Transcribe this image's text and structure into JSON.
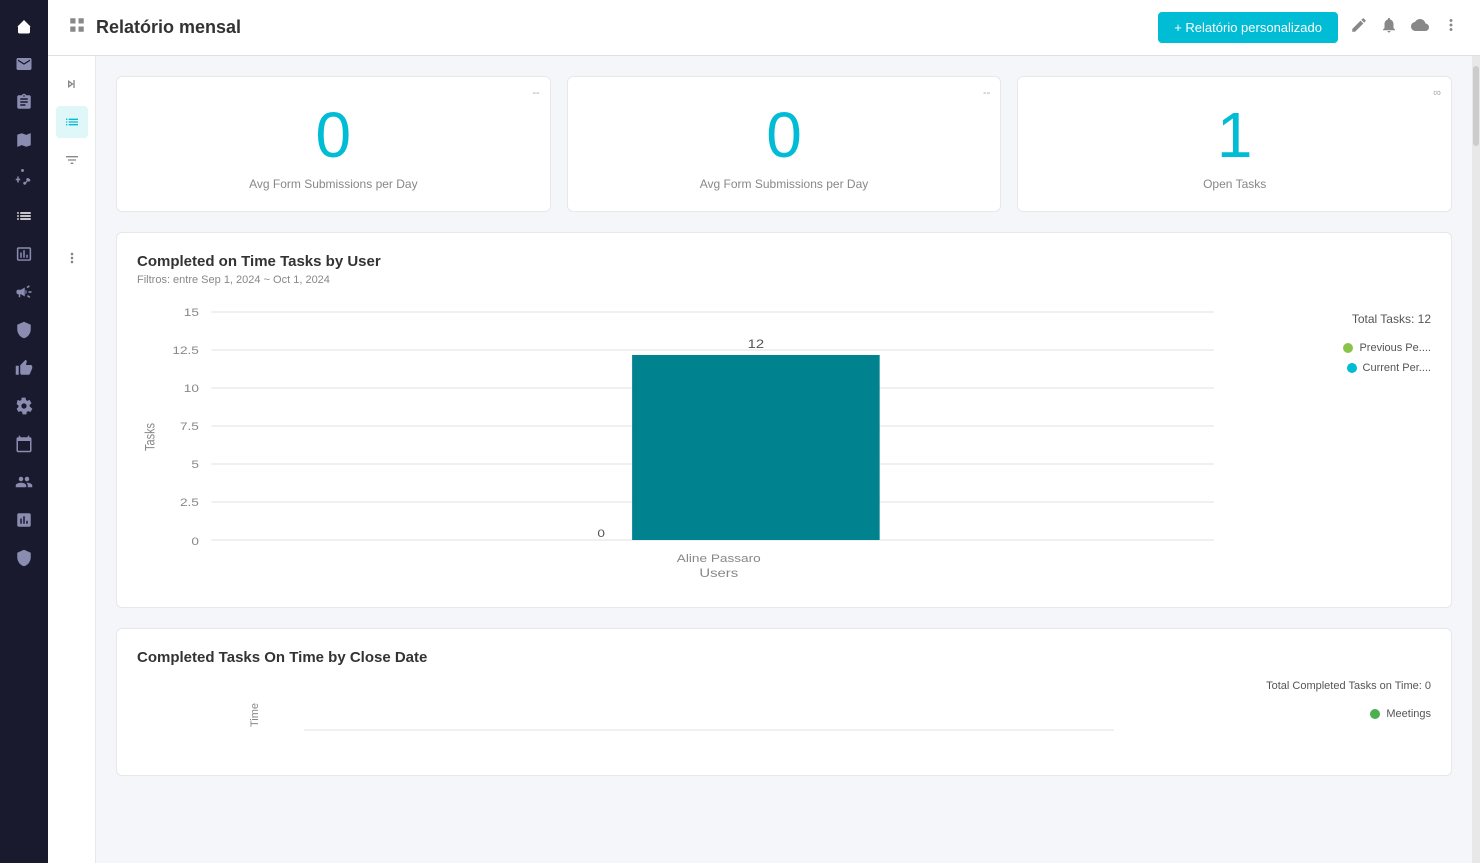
{
  "sidebar": {
    "icons": [
      {
        "name": "home-icon",
        "symbol": "⊞"
      },
      {
        "name": "email-icon",
        "symbol": "✉"
      },
      {
        "name": "document-icon",
        "symbol": "📋"
      },
      {
        "name": "map-icon",
        "symbol": "🗺"
      },
      {
        "name": "branch-icon",
        "symbol": "⑂"
      },
      {
        "name": "list-icon",
        "symbol": "☰"
      },
      {
        "name": "report-icon",
        "symbol": "📊"
      },
      {
        "name": "megaphone-icon",
        "symbol": "📣"
      },
      {
        "name": "badge-icon",
        "symbol": "🏅"
      },
      {
        "name": "thumb-icon",
        "symbol": "👍"
      },
      {
        "name": "settings-gear-icon",
        "symbol": "⚙"
      },
      {
        "name": "calendar-icon",
        "symbol": "📅"
      },
      {
        "name": "people-icon",
        "symbol": "👥"
      },
      {
        "name": "chart-icon",
        "symbol": "📈"
      },
      {
        "name": "shield-icon",
        "symbol": "🛡"
      }
    ]
  },
  "topbar": {
    "title": "Relatório mensal",
    "custom_report_btn": "+ Relatório personalizado"
  },
  "left_panel": {
    "icons": [
      {
        "name": "collapse-icon",
        "symbol": "»"
      },
      {
        "name": "list-view-icon",
        "symbol": "≡",
        "active": true
      },
      {
        "name": "filter-icon",
        "symbol": "⊟"
      },
      {
        "name": "more-vert-icon",
        "symbol": "⋮"
      }
    ]
  },
  "kpi_cards": [
    {
      "id": "card1",
      "value": "0",
      "label": "Avg Form Submissions per Day",
      "menu": "--"
    },
    {
      "id": "card2",
      "value": "0",
      "label": "Avg Form Submissions per Day",
      "menu": "--"
    },
    {
      "id": "card3",
      "value": "1",
      "label": "Open Tasks",
      "menu": "∞"
    }
  ],
  "chart1": {
    "title": "Completed on Time Tasks by User",
    "subtitle": "Filtros: entre Sep 1, 2024 ~ Oct 1, 2024",
    "total_label": "Total Tasks: 12",
    "y_axis_labels": [
      "0",
      "2.5",
      "5",
      "7.5",
      "10",
      "12.5",
      "15"
    ],
    "x_axis_label": "Users",
    "x_axis_value": "Aline Passaro",
    "bars": [
      {
        "user": "Aline Passaro",
        "previous": 0,
        "current": 12,
        "label_prev": "0",
        "label_curr": "12"
      }
    ],
    "legend": [
      {
        "label": "Previous Pe....",
        "color": "#8bc34a"
      },
      {
        "label": "Current Per....",
        "color": "#00bcd4"
      }
    ],
    "y_axis_title": "Tasks",
    "bar_color": "#00838f"
  },
  "chart2": {
    "title": "Completed Tasks On Time by Close Date",
    "total_label": "Total Completed Tasks on Time: 0",
    "legend": [
      {
        "label": "Meetings",
        "color": "#4caf50"
      }
    ],
    "y_axis_title": "Time"
  }
}
